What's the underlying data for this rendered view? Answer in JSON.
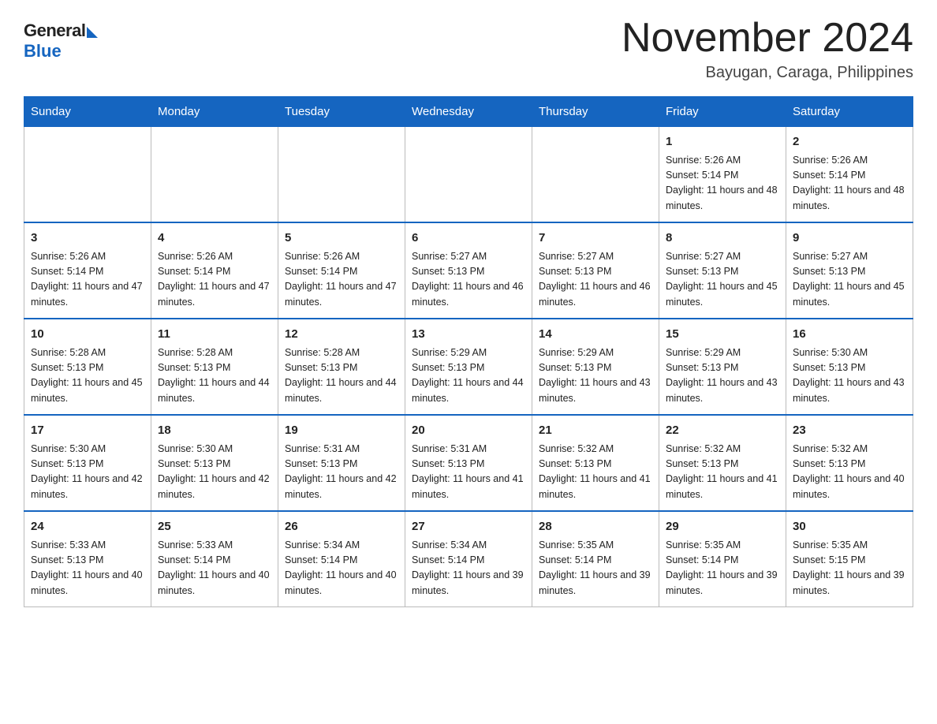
{
  "header": {
    "logo_general": "General",
    "logo_blue": "Blue",
    "month_title": "November 2024",
    "location": "Bayugan, Caraga, Philippines"
  },
  "days_of_week": [
    "Sunday",
    "Monday",
    "Tuesday",
    "Wednesday",
    "Thursday",
    "Friday",
    "Saturday"
  ],
  "weeks": [
    [
      {
        "day": "",
        "info": ""
      },
      {
        "day": "",
        "info": ""
      },
      {
        "day": "",
        "info": ""
      },
      {
        "day": "",
        "info": ""
      },
      {
        "day": "",
        "info": ""
      },
      {
        "day": "1",
        "info": "Sunrise: 5:26 AM\nSunset: 5:14 PM\nDaylight: 11 hours and 48 minutes."
      },
      {
        "day": "2",
        "info": "Sunrise: 5:26 AM\nSunset: 5:14 PM\nDaylight: 11 hours and 48 minutes."
      }
    ],
    [
      {
        "day": "3",
        "info": "Sunrise: 5:26 AM\nSunset: 5:14 PM\nDaylight: 11 hours and 47 minutes."
      },
      {
        "day": "4",
        "info": "Sunrise: 5:26 AM\nSunset: 5:14 PM\nDaylight: 11 hours and 47 minutes."
      },
      {
        "day": "5",
        "info": "Sunrise: 5:26 AM\nSunset: 5:14 PM\nDaylight: 11 hours and 47 minutes."
      },
      {
        "day": "6",
        "info": "Sunrise: 5:27 AM\nSunset: 5:13 PM\nDaylight: 11 hours and 46 minutes."
      },
      {
        "day": "7",
        "info": "Sunrise: 5:27 AM\nSunset: 5:13 PM\nDaylight: 11 hours and 46 minutes."
      },
      {
        "day": "8",
        "info": "Sunrise: 5:27 AM\nSunset: 5:13 PM\nDaylight: 11 hours and 45 minutes."
      },
      {
        "day": "9",
        "info": "Sunrise: 5:27 AM\nSunset: 5:13 PM\nDaylight: 11 hours and 45 minutes."
      }
    ],
    [
      {
        "day": "10",
        "info": "Sunrise: 5:28 AM\nSunset: 5:13 PM\nDaylight: 11 hours and 45 minutes."
      },
      {
        "day": "11",
        "info": "Sunrise: 5:28 AM\nSunset: 5:13 PM\nDaylight: 11 hours and 44 minutes."
      },
      {
        "day": "12",
        "info": "Sunrise: 5:28 AM\nSunset: 5:13 PM\nDaylight: 11 hours and 44 minutes."
      },
      {
        "day": "13",
        "info": "Sunrise: 5:29 AM\nSunset: 5:13 PM\nDaylight: 11 hours and 44 minutes."
      },
      {
        "day": "14",
        "info": "Sunrise: 5:29 AM\nSunset: 5:13 PM\nDaylight: 11 hours and 43 minutes."
      },
      {
        "day": "15",
        "info": "Sunrise: 5:29 AM\nSunset: 5:13 PM\nDaylight: 11 hours and 43 minutes."
      },
      {
        "day": "16",
        "info": "Sunrise: 5:30 AM\nSunset: 5:13 PM\nDaylight: 11 hours and 43 minutes."
      }
    ],
    [
      {
        "day": "17",
        "info": "Sunrise: 5:30 AM\nSunset: 5:13 PM\nDaylight: 11 hours and 42 minutes."
      },
      {
        "day": "18",
        "info": "Sunrise: 5:30 AM\nSunset: 5:13 PM\nDaylight: 11 hours and 42 minutes."
      },
      {
        "day": "19",
        "info": "Sunrise: 5:31 AM\nSunset: 5:13 PM\nDaylight: 11 hours and 42 minutes."
      },
      {
        "day": "20",
        "info": "Sunrise: 5:31 AM\nSunset: 5:13 PM\nDaylight: 11 hours and 41 minutes."
      },
      {
        "day": "21",
        "info": "Sunrise: 5:32 AM\nSunset: 5:13 PM\nDaylight: 11 hours and 41 minutes."
      },
      {
        "day": "22",
        "info": "Sunrise: 5:32 AM\nSunset: 5:13 PM\nDaylight: 11 hours and 41 minutes."
      },
      {
        "day": "23",
        "info": "Sunrise: 5:32 AM\nSunset: 5:13 PM\nDaylight: 11 hours and 40 minutes."
      }
    ],
    [
      {
        "day": "24",
        "info": "Sunrise: 5:33 AM\nSunset: 5:13 PM\nDaylight: 11 hours and 40 minutes."
      },
      {
        "day": "25",
        "info": "Sunrise: 5:33 AM\nSunset: 5:14 PM\nDaylight: 11 hours and 40 minutes."
      },
      {
        "day": "26",
        "info": "Sunrise: 5:34 AM\nSunset: 5:14 PM\nDaylight: 11 hours and 40 minutes."
      },
      {
        "day": "27",
        "info": "Sunrise: 5:34 AM\nSunset: 5:14 PM\nDaylight: 11 hours and 39 minutes."
      },
      {
        "day": "28",
        "info": "Sunrise: 5:35 AM\nSunset: 5:14 PM\nDaylight: 11 hours and 39 minutes."
      },
      {
        "day": "29",
        "info": "Sunrise: 5:35 AM\nSunset: 5:14 PM\nDaylight: 11 hours and 39 minutes."
      },
      {
        "day": "30",
        "info": "Sunrise: 5:35 AM\nSunset: 5:15 PM\nDaylight: 11 hours and 39 minutes."
      }
    ]
  ]
}
